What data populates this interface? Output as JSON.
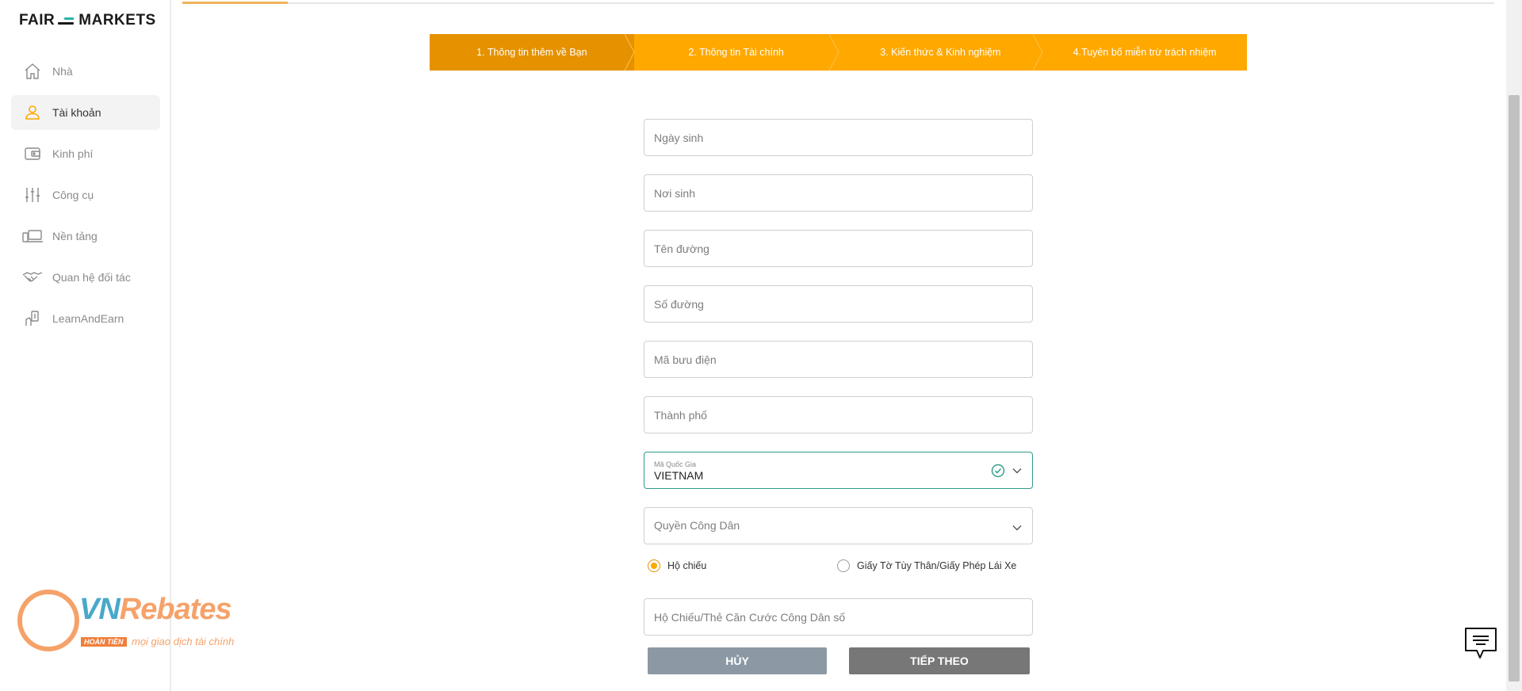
{
  "brand": {
    "left": "FAIR",
    "right": "MARKETS"
  },
  "sidebar": {
    "items": [
      {
        "label": "Nhà",
        "icon": "home-icon",
        "active": false
      },
      {
        "label": "Tài khoản",
        "icon": "user-icon",
        "active": true
      },
      {
        "label": "Kinh phí",
        "icon": "wallet-icon",
        "active": false
      },
      {
        "label": "Công cụ",
        "icon": "sliders-icon",
        "active": false
      },
      {
        "label": "Nền tảng",
        "icon": "devices-icon",
        "active": false
      },
      {
        "label": "Quan hệ đối tác",
        "icon": "handshake-icon",
        "active": false
      },
      {
        "label": "LearnAndEarn",
        "icon": "money-hand-icon",
        "active": false
      }
    ]
  },
  "stepper": {
    "steps": [
      "1. Thông tin thêm về Bạn",
      "2. Thông tin Tài chính",
      "3. Kiến thức & Kinh nghiệm",
      "4.Tuyên bố miễn trừ trách nhiệm"
    ],
    "active_index": 0
  },
  "form": {
    "birth_date_placeholder": "Ngày sinh",
    "birth_place_placeholder": "Nơi sinh",
    "street_name_placeholder": "Tên đường",
    "street_number_placeholder": "Số đường",
    "postal_code_placeholder": "Mã bưu điện",
    "city_placeholder": "Thành phố",
    "country_code_label": "Mã Quốc Gia",
    "country_code_value": "VIETNAM",
    "citizenship_placeholder": "Quyền Công Dân",
    "id_type_passport": "Hộ chiếu",
    "id_type_other": "Giấy Tờ Tùy Thân/Giấy Phép Lái Xe",
    "id_number_placeholder": "Hộ Chiếu/Thẻ Căn Cước Công Dân số"
  },
  "buttons": {
    "cancel": "HỦY",
    "next": "TIẾP THEO"
  },
  "watermark": {
    "brand_vn": "VN",
    "brand_rest": "Rebates",
    "tag": "HOÀN TIỀN",
    "slogan": "mọi giao dịch tài chính"
  },
  "colors": {
    "accent": "#ffa800",
    "accent_dark": "#e59100",
    "valid": "#2f9c8c",
    "cancel": "#8c99a4",
    "next": "#777777"
  }
}
